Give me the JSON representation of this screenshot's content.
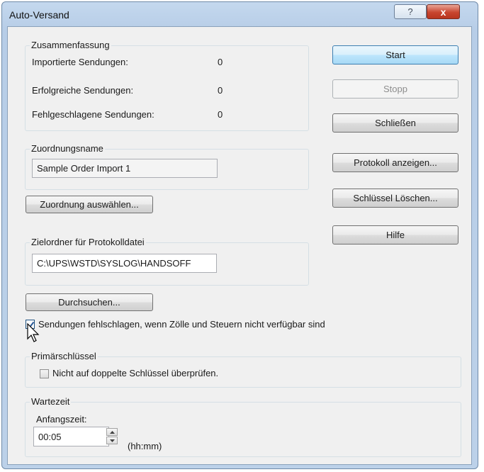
{
  "window": {
    "title": "Auto-Versand",
    "help_icon": "?",
    "close_icon": "x"
  },
  "summary": {
    "label": "Zusammenfassung",
    "rows": [
      {
        "label": "Importierte Sendungen:",
        "value": "0"
      },
      {
        "label": "Erfolgreiche Sendungen:",
        "value": "0"
      },
      {
        "label": "Fehlgeschlagene Sendungen:",
        "value": "0"
      }
    ]
  },
  "mapping": {
    "label": "Zuordnungsname",
    "value": "Sample Order Import 1",
    "select_button": "Zuordnung auswählen..."
  },
  "log_folder": {
    "label": "Zielordner für Protokolldatei",
    "value": "C:\\UPS\\WSTD\\SYSLOG\\HANDSOFF",
    "browse_button": "Durchsuchen..."
  },
  "fail_option": {
    "label": "Sendungen fehlschlagen, wenn Zölle und Steuern nicht verfügbar sind",
    "checked": true
  },
  "primary_key": {
    "label": "Primärschlüssel",
    "option_label": "Nicht auf doppelte Schlüssel überprüfen.",
    "checked": false
  },
  "wait": {
    "label": "Wartezeit",
    "start_label": "Anfangszeit:",
    "value": "00:05",
    "unit": "(hh:mm)"
  },
  "buttons": {
    "start": "Start",
    "stop": "Stopp",
    "close": "Schließen",
    "show_log": "Protokoll anzeigen...",
    "delete_keys": "Schlüssel Löschen...",
    "help": "Hilfe"
  },
  "colors": {
    "titlebar": "#bcd1e9",
    "dialog_background": "#f0f0f0",
    "close_button": "#c8452f",
    "default_button_border": "#3c7fb1"
  }
}
